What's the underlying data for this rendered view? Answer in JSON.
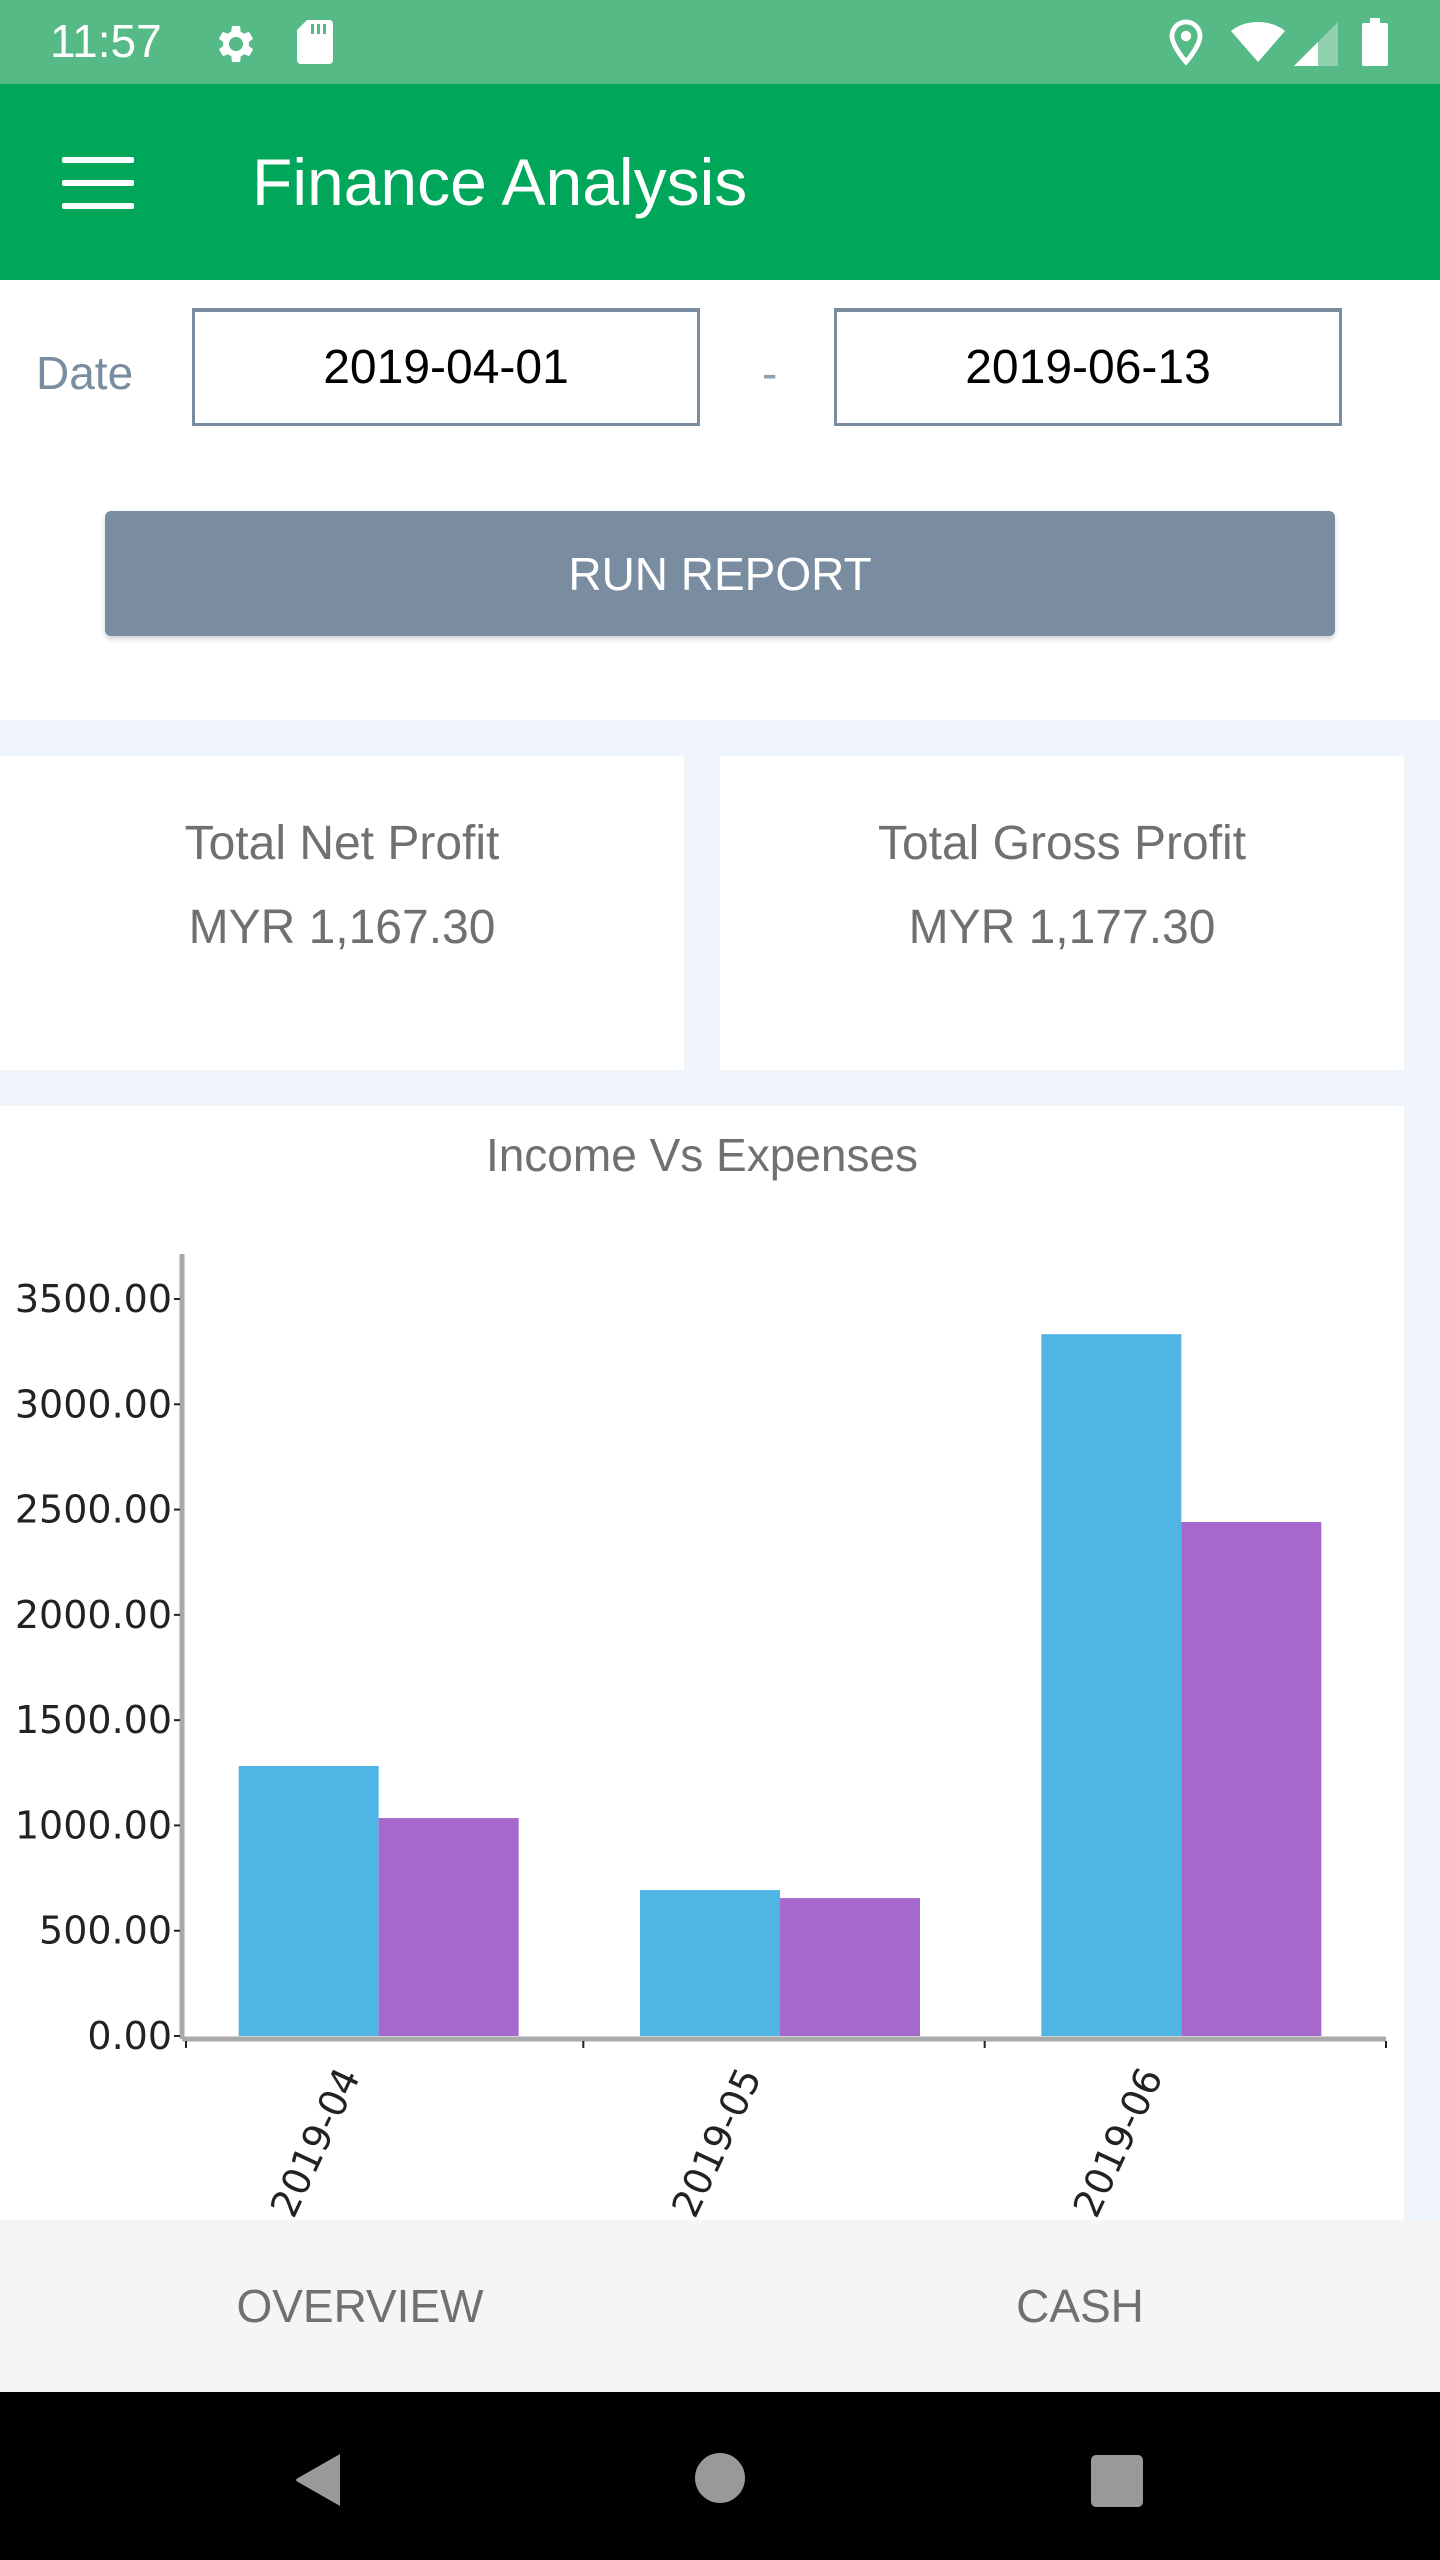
{
  "status_bar": {
    "time": "11:57",
    "left_icons": [
      "gear-icon",
      "sd-card-icon"
    ],
    "right_icons": [
      "location-icon",
      "wifi-icon",
      "signal-icon",
      "battery-icon"
    ]
  },
  "app_bar": {
    "title": "Finance Analysis",
    "menu_icon": "hamburger-menu-icon"
  },
  "filters": {
    "date_label": "Date",
    "start_date": "2019-04-01",
    "separator": "-",
    "end_date": "2019-06-13",
    "run_button_label": "RUN REPORT"
  },
  "summary_cards": [
    {
      "title": "Total Net Profit",
      "value": "MYR 1,167.30"
    },
    {
      "title": "Total Gross Profit",
      "value": "MYR 1,177.30"
    }
  ],
  "colors": {
    "primary": "#00a65a",
    "status_bar": "#55ba85",
    "button": "#7a8ca0",
    "income": "#4fb5e5",
    "expenses": "#a568cc"
  },
  "chart_data": {
    "type": "bar",
    "title": "Income Vs Expenses",
    "xlabel": "",
    "ylabel": "",
    "categories": [
      "2019-04",
      "2019-05",
      "2019-06"
    ],
    "series": [
      {
        "name": "Income",
        "color": "#4fb5e5",
        "values": [
          1282,
          693,
          3333
        ]
      },
      {
        "name": "Expenses",
        "color": "#a568cc",
        "values": [
          1035,
          655,
          2441
        ]
      }
    ],
    "ylim": [
      0,
      3500
    ],
    "yticks": [
      0,
      500,
      1000,
      1500,
      2000,
      2500,
      3000,
      3500
    ],
    "ytick_labels": [
      "0.00",
      "500.00",
      "1000.00",
      "1500.00",
      "2000.00",
      "2500.00",
      "3000.00",
      "3500.00"
    ],
    "grid": false,
    "legend": "none",
    "xtick_rotation_deg": -65
  },
  "tabs": [
    {
      "label": "OVERVIEW"
    },
    {
      "label": "CASH"
    }
  ],
  "nav_bar": {
    "buttons": [
      "back-icon",
      "home-icon",
      "recents-icon"
    ]
  }
}
